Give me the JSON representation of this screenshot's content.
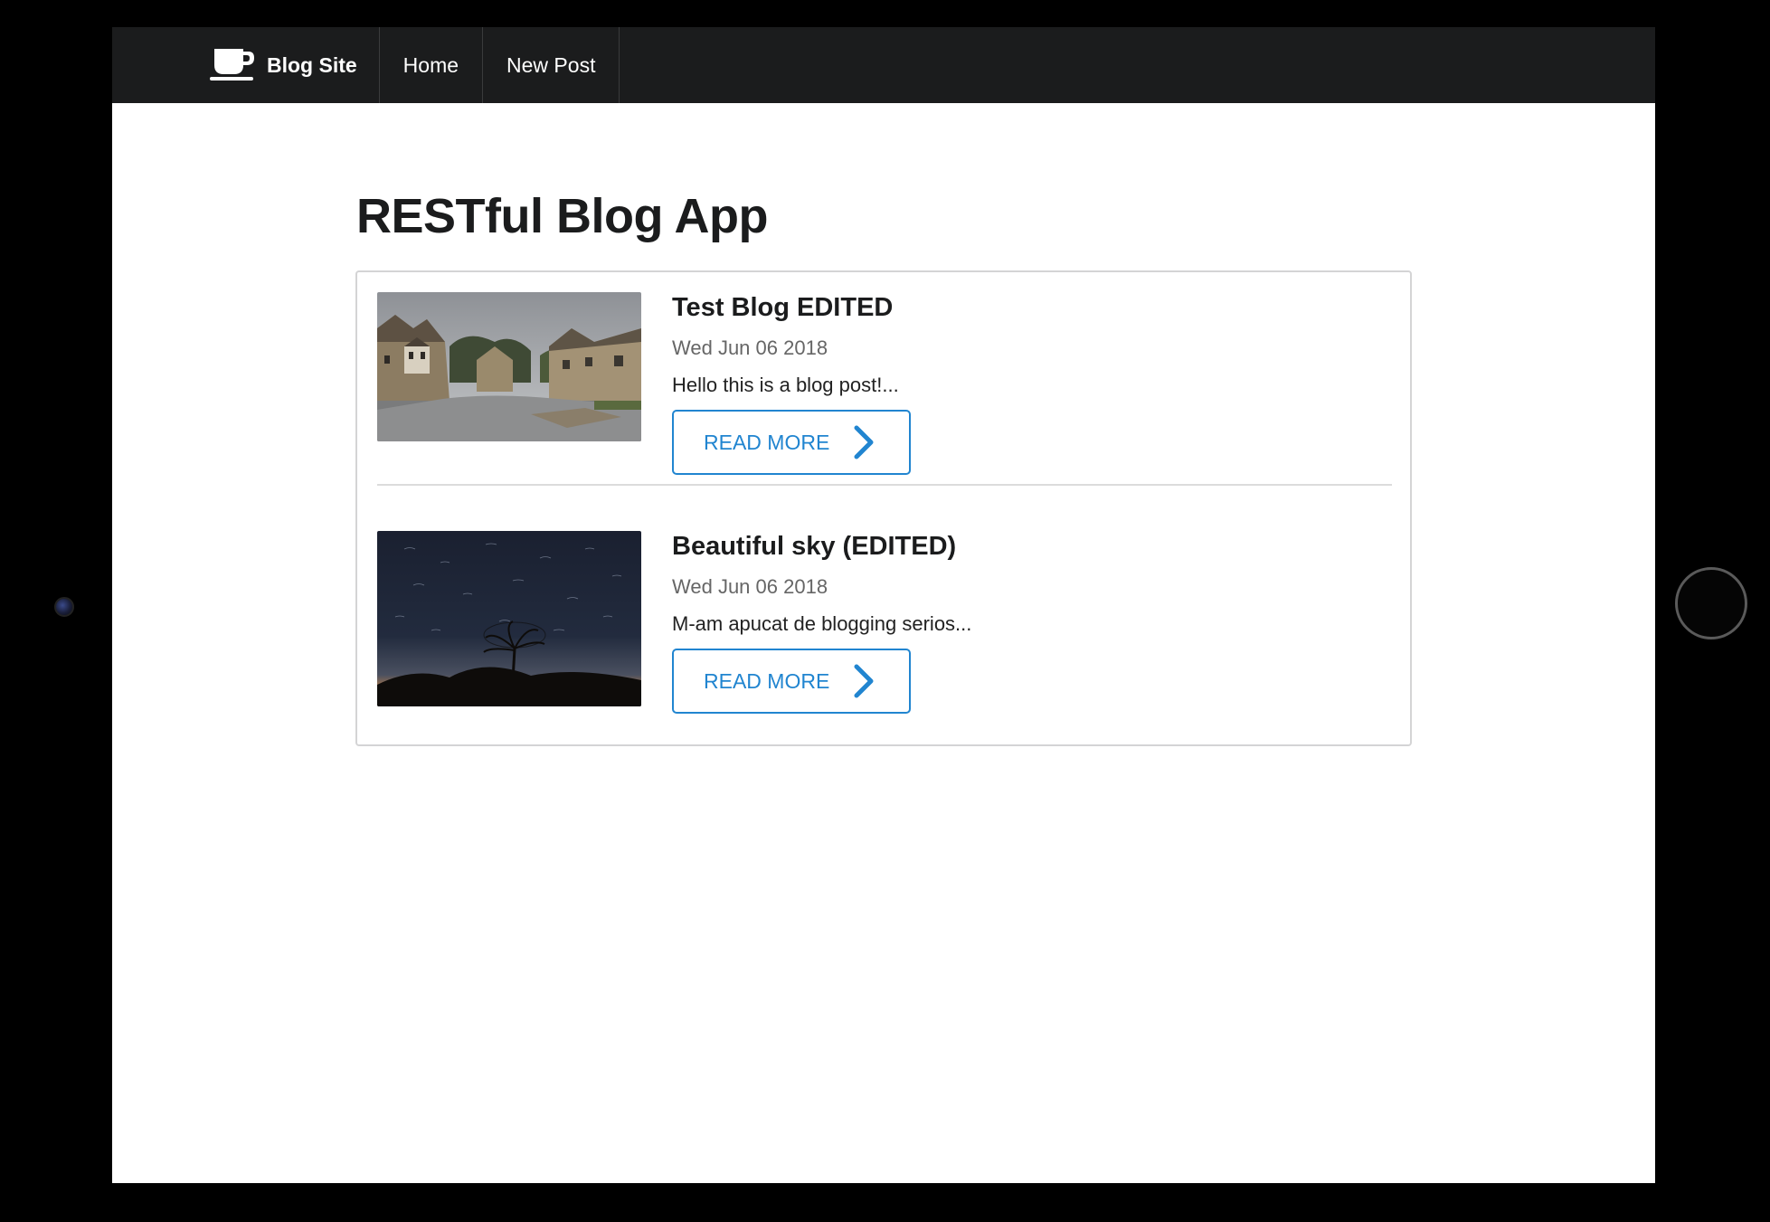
{
  "navbar": {
    "brand": "Blog Site",
    "brand_icon": "coffee-cup-icon",
    "items": [
      {
        "label": "Home"
      },
      {
        "label": "New Post"
      }
    ],
    "background": "#1b1c1d"
  },
  "page": {
    "title": "RESTful Blog App"
  },
  "posts": [
    {
      "title": "Test Blog EDITED",
      "date": "Wed Jun 06 2018",
      "excerpt": "Hello this is a blog post!...",
      "button_label": "READ MORE",
      "button_icon": "chevron-right-icon",
      "image": "village-street-photo"
    },
    {
      "title": "Beautiful sky (EDITED)",
      "date": "Wed Jun 06 2018",
      "excerpt": "M-am apucat de blogging serios...",
      "button_label": "READ MORE",
      "button_icon": "chevron-right-icon",
      "image": "night-sky-tree-photo"
    }
  ],
  "colors": {
    "accent": "#2185d0",
    "text": "#1b1c1d",
    "muted": "#666666"
  }
}
